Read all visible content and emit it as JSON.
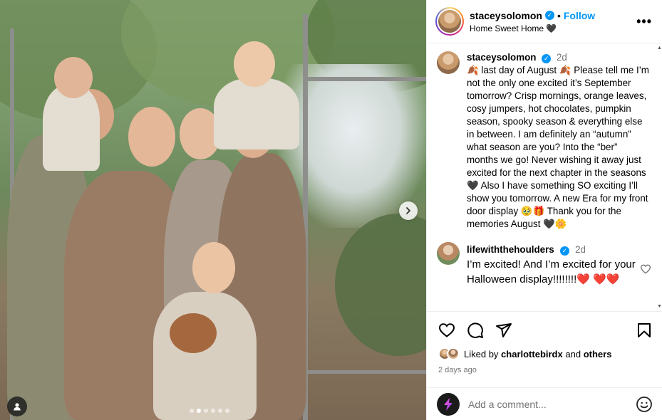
{
  "post": {
    "username": "staceysolomon",
    "separator": "•",
    "follow_label": "Follow",
    "location": "Home Sweet Home 🖤",
    "more_label": "•••"
  },
  "caption": {
    "username": "staceysolomon",
    "time": "2d",
    "text": "🍂 last day of August 🍂 Please tell me I’m not the only one excited it’s September tomorrow? Crisp mornings, orange leaves, cosy jumpers, hot chocolates, pumpkin season, spooky season & everything else in between. I am definitely an “autumn” what season are you? Into the “ber” months we go! Never wishing it away just excited for the next chapter in the seasons 🖤 Also I have something SO exciting I’ll show you tomorrow. A new Era for my front door display 🥹🎁 Thank you for the memories August 🖤🌼"
  },
  "comments": [
    {
      "username": "lifewiththehoulders",
      "time": "2d",
      "text": "I’m excited! And I’m excited for your Halloween display!!!!!!!!❤️ ❤️❤️"
    }
  ],
  "likes": {
    "prefix": "Liked by",
    "user": "charlottebirdx",
    "and": "and",
    "others": "others"
  },
  "timestamp": "2 days ago",
  "add_comment": {
    "placeholder": "Add a comment..."
  },
  "carousel": {
    "slide_count": 6,
    "active_index": 1
  },
  "colors": {
    "link": "#0095f6",
    "muted": "#737373",
    "divider": "#efefef"
  },
  "icons": {
    "like": "heart-icon",
    "comment": "comment-icon",
    "share": "paper-plane-icon",
    "save": "bookmark-icon",
    "emoji": "smiley-icon",
    "next": "chevron-right-icon",
    "tag": "person-icon"
  }
}
